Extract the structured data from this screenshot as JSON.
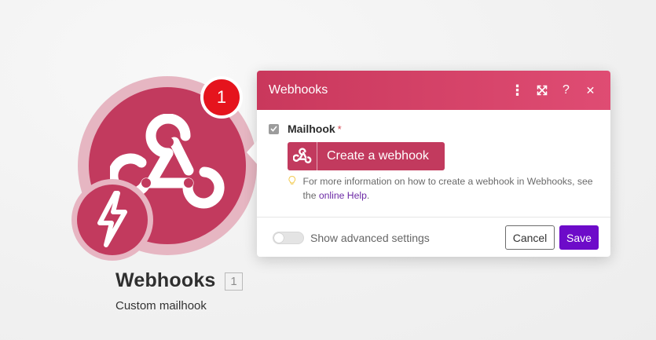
{
  "module": {
    "notification_count": "1",
    "title": "Webhooks",
    "count": "1",
    "subtitle": "Custom mailhook",
    "icon": "webhook-icon",
    "instant_icon": "lightning-bolt-icon",
    "color": "#c23a5e"
  },
  "dialog": {
    "title": "Webhooks",
    "header_icons": [
      "more-vertical-icon",
      "expand-icon",
      "help-icon",
      "close-icon"
    ],
    "header_glyphs": {
      "more": "⋮",
      "help": "?",
      "close": "✕"
    },
    "field": {
      "label": "Mailhook",
      "required_mark": "*",
      "create_button_label": "Create a webhook"
    },
    "hint": {
      "text": "For more information on how to create a webhook in Webhooks, see the",
      "link_text": "online Help",
      "suffix": "."
    },
    "footer": {
      "toggle_label": "Show advanced settings",
      "advanced_settings_enabled": false,
      "cancel_label": "Cancel",
      "save_label": "Save"
    },
    "colors": {
      "header_gradient_start": "#c9385c",
      "header_gradient_end": "#df4c73",
      "save_button": "#6d0bc9",
      "link": "#6c2aa5"
    }
  }
}
